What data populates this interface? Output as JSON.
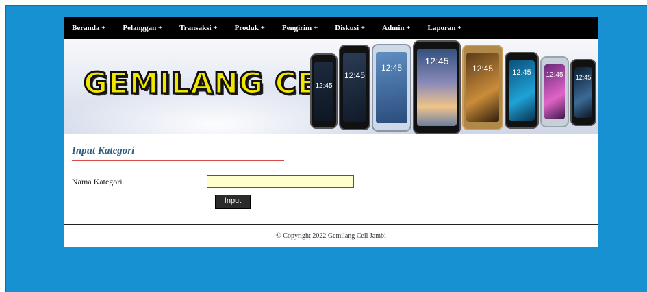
{
  "nav": {
    "items": [
      "Beranda +",
      "Pelanggan +",
      "Transaksi +",
      "Produk +",
      "Pengirim +",
      "Diskusi +",
      "Admin +",
      "Laporan +"
    ]
  },
  "banner": {
    "title": "GEMILANG CELL",
    "phone_clock": "12:45"
  },
  "page": {
    "title": "Input Kategori"
  },
  "form": {
    "label": "Nama Kategori",
    "value": "",
    "submit_label": "Input"
  },
  "footer": {
    "text": "© Copyright 2022 Gemilang Cell Jambi"
  },
  "colors": {
    "background": "#1791d2",
    "nav": "#000000",
    "title": "#2a5f86",
    "title_underline": "#d94a4a",
    "input_bg": "#ffffcc",
    "logo_text": "#f2e600"
  }
}
